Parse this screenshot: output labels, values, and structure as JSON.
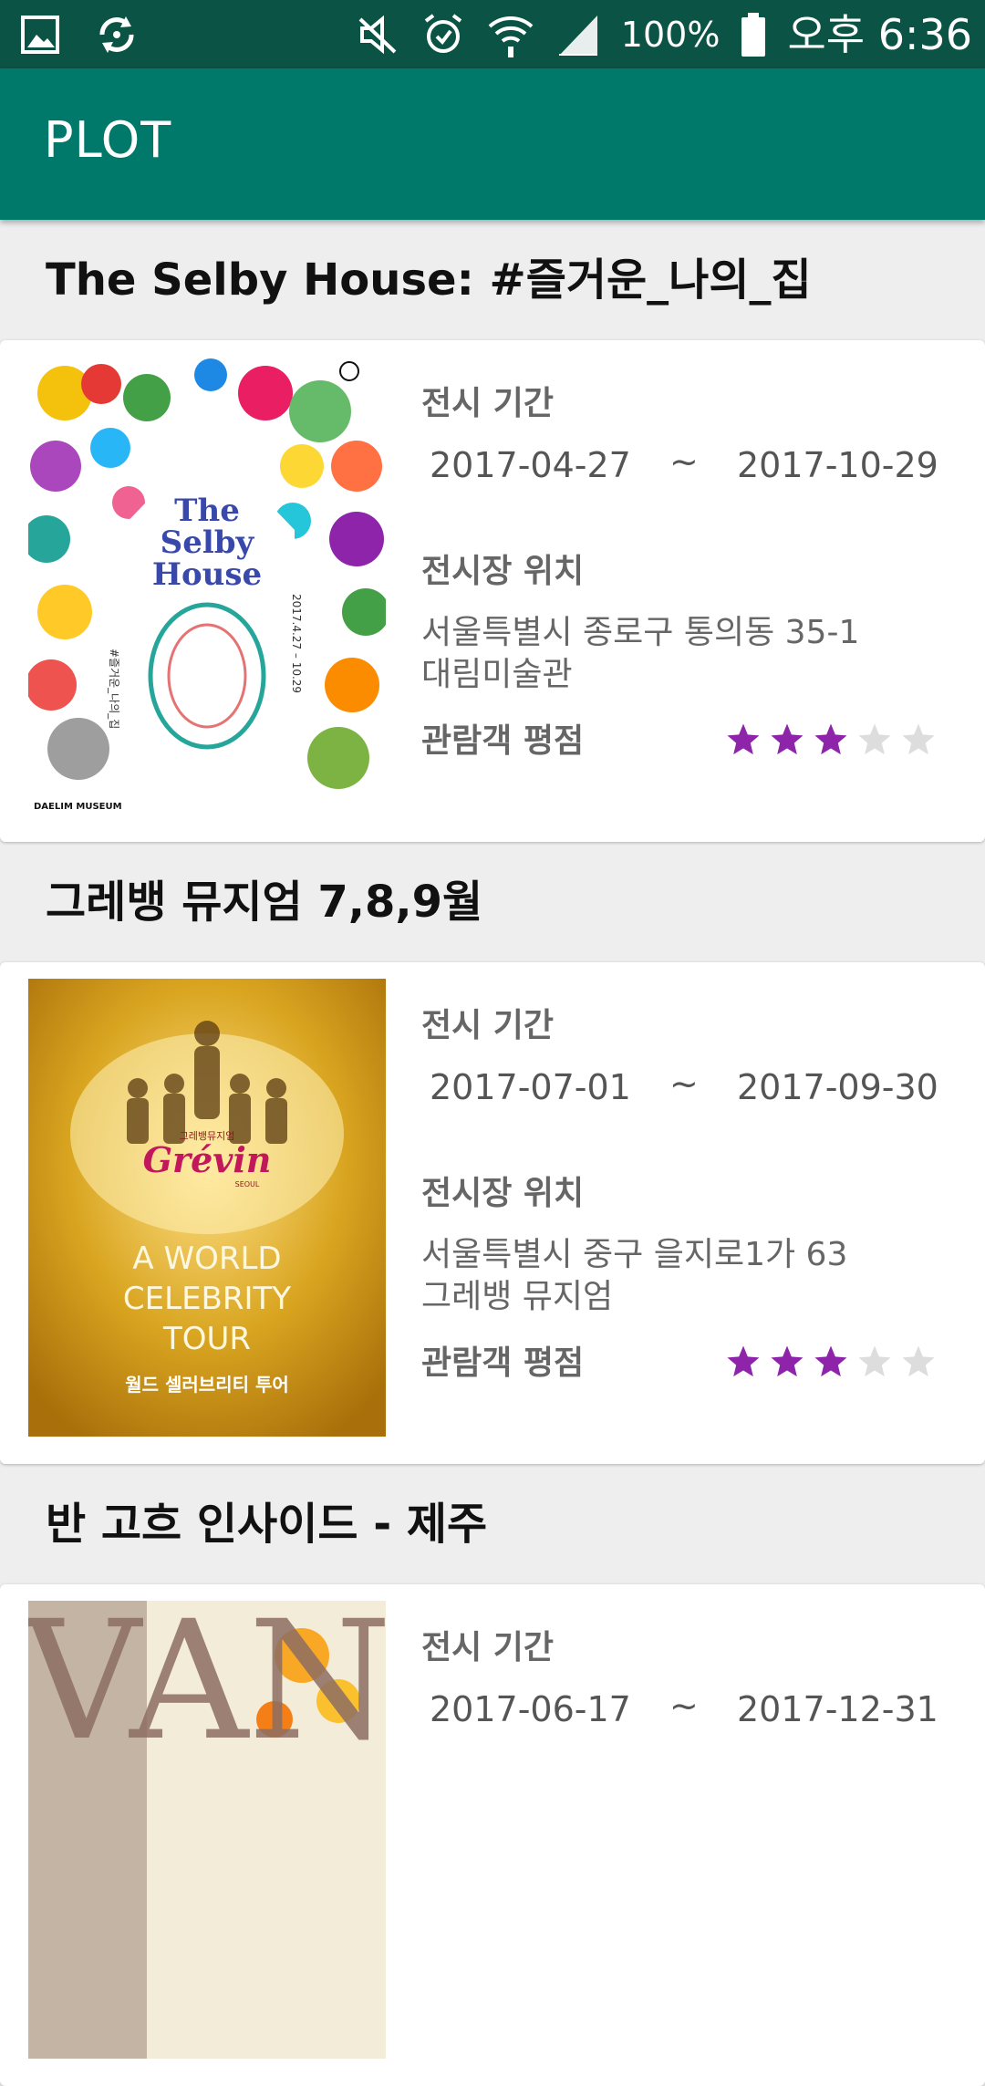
{
  "status_bar": {
    "battery": "100%",
    "time": "오후 6:36",
    "icons": [
      "gallery-icon",
      "sync-icon",
      "mute-icon",
      "alarm-icon",
      "wifi-icon",
      "signal-icon",
      "battery-icon"
    ]
  },
  "app_bar": {
    "title": "PLOT"
  },
  "colors": {
    "status_bar": "#0b5345",
    "app_bar": "#00796b",
    "star_filled": "#8e24aa",
    "star_empty": "#dddddd"
  },
  "labels": {
    "period": "전시 기간",
    "location": "전시장 위치",
    "rating": "관람객 평점",
    "tilde": "~"
  },
  "exhibitions": [
    {
      "title": "The Selby House: #즐거운_나의_집",
      "start": "2017-04-27",
      "end": "2017-10-29",
      "address_line1": "서울특별시 종로구 통의동 35-1",
      "address_line2": "대림미술관",
      "rating": 3,
      "rating_max": 5,
      "poster": {
        "title_lines": [
          "The",
          "Selby",
          "House"
        ],
        "side_text_left": "#즐거운_나의_집",
        "side_text_right": "2017.4.27 – 10.29",
        "footer": "DAELIM MUSEUM"
      }
    },
    {
      "title": "그레뱅 뮤지엄 7,8,9월",
      "start": "2017-07-01",
      "end": "2017-09-30",
      "address_line1": "서울특별시 중구 을지로1가 63",
      "address_line2": "그레뱅 뮤지엄",
      "rating": 3,
      "rating_max": 5,
      "poster": {
        "small_text": "그레뱅뮤지엄",
        "brand": "Grévin",
        "brand_sub": "SEOUL",
        "lines": [
          "A WORLD",
          "CELEBRITY",
          "TOUR"
        ],
        "korean": "월드 셀러브리티 투어"
      }
    },
    {
      "title": "반 고흐 인사이드 - 제주",
      "start": "2017-06-17",
      "end": "2017-12-31",
      "rating_max": 5,
      "poster": {
        "letters": "VAN"
      }
    }
  ]
}
